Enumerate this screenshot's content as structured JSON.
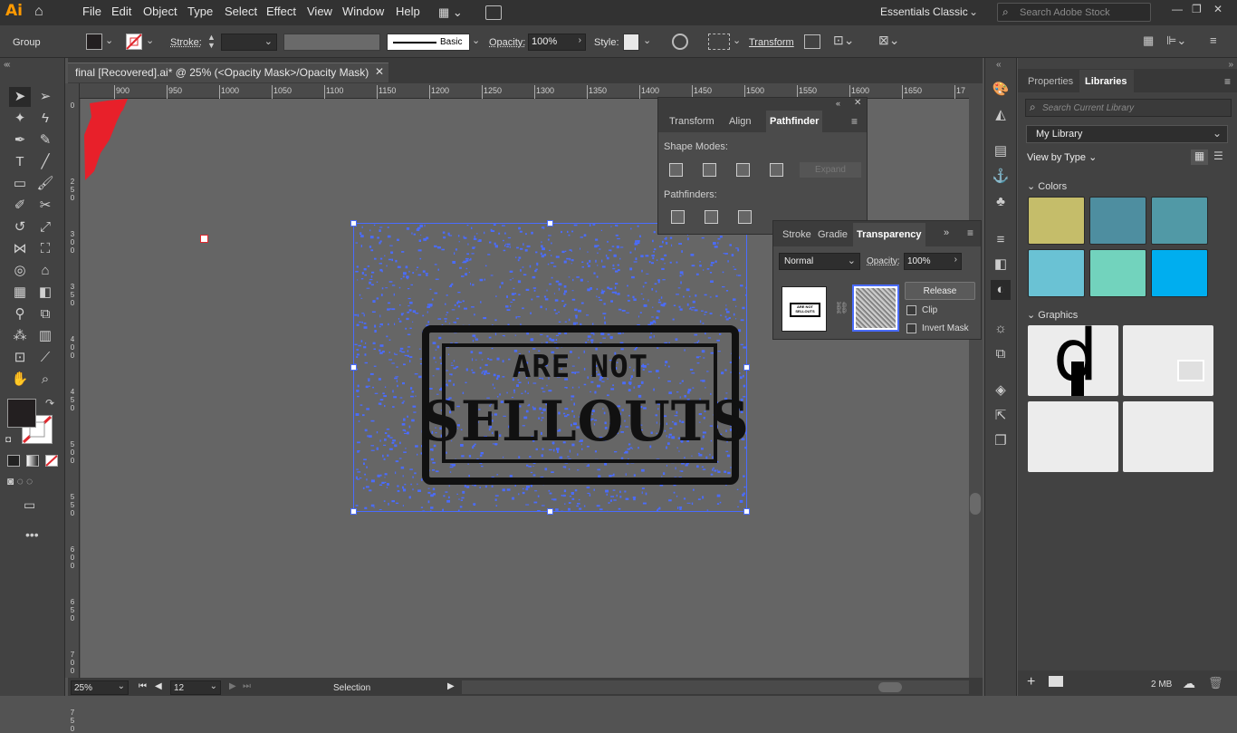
{
  "app": {
    "logo": "Ai",
    "workspace": "Essentials Classic",
    "search_placeholder": "Search Adobe Stock"
  },
  "menu": [
    "File",
    "Edit",
    "Object",
    "Type",
    "Select",
    "Effect",
    "View",
    "Window",
    "Help"
  ],
  "control_bar": {
    "selection_type": "Group",
    "stroke_label": "Stroke:",
    "brush_label": "Basic",
    "opacity_label": "Opacity:",
    "opacity_value": "100%",
    "style_label": "Style:",
    "transform_label": "Transform"
  },
  "document": {
    "tab_title": "final [Recovered].ai* @ 25% (<Opacity Mask>/Opacity Mask)",
    "zoom": "25%",
    "artboard": "12",
    "status_tool": "Selection"
  },
  "ruler_h": [
    "900",
    "950",
    "1000",
    "1050",
    "1100",
    "1150",
    "1200",
    "1250",
    "1300",
    "1350",
    "1400",
    "1450",
    "1500",
    "1550",
    "1600",
    "1650",
    "17"
  ],
  "ruler_v": [
    "0",
    "2 5 0",
    "3 0 0",
    "3 5 0",
    "4 0 0",
    "4 5 0",
    "5 0 0",
    "5 5 0",
    "6 0 0",
    "6 5 0",
    "7 0 0",
    "7 5 0"
  ],
  "artwork": {
    "line1": "ARE NOT",
    "line2": "SELLOUTS",
    "thumb_text1": "ARE NOT",
    "thumb_text2": "SELLOUTS"
  },
  "pathfinder_panel": {
    "tabs": [
      "Transform",
      "Align",
      "Pathfinder"
    ],
    "active": "Pathfinder",
    "shape_modes_label": "Shape Modes:",
    "expand_label": "Expand",
    "pathfinders_label": "Pathfinders:"
  },
  "transparency_panel": {
    "tabs": [
      "Stroke",
      "Gradie",
      "Transparency"
    ],
    "active": "Transparency",
    "blend_mode": "Normal",
    "opacity_label": "Opacity:",
    "opacity_value": "100%",
    "release_label": "Release",
    "clip_label": "Clip",
    "invert_label": "Invert Mask"
  },
  "libraries": {
    "tabs": [
      "Properties",
      "Libraries"
    ],
    "active": "Libraries",
    "search_placeholder": "Search Current Library",
    "library_name": "My Library",
    "view_by": "View by Type",
    "colors_label": "Colors",
    "graphics_label": "Graphics",
    "size_label": "2 MB",
    "colors": [
      "#c5bd6a",
      "#4e8ea0",
      "#5199a6",
      "#6ac2d4",
      "#72d3bd",
      "#00aeef"
    ]
  },
  "colors": {
    "accent": "#4a6cff",
    "fill": "#231f20",
    "none_stroke": "#e0282e"
  }
}
